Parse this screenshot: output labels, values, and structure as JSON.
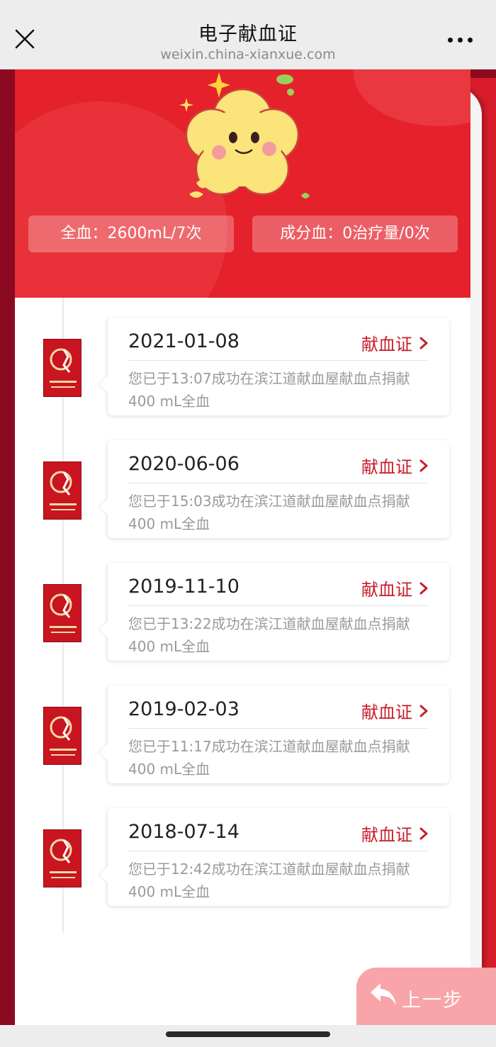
{
  "header": {
    "title": "电子献血证",
    "url": "weixin.china-xianxue.com"
  },
  "summary": {
    "whole_blood": "全血：2600mL/7次",
    "component_blood": "成分血：0治疗量/0次"
  },
  "records": [
    {
      "date": "2021-01-08",
      "link_label": "献血证",
      "description": "您已于13:07成功在滨江道献血屋献血点捐献400 mL全血"
    },
    {
      "date": "2020-06-06",
      "link_label": "献血证",
      "description": "您已于15:03成功在滨江道献血屋献血点捐献400 mL全血"
    },
    {
      "date": "2019-11-10",
      "link_label": "献血证",
      "description": "您已于13:22成功在滨江道献血屋献血点捐献400 mL全血"
    },
    {
      "date": "2019-02-03",
      "link_label": "献血证",
      "description": "您已于11:17成功在滨江道献血屋献血点捐献400 mL全血"
    },
    {
      "date": "2018-07-14",
      "link_label": "献血证",
      "description": "您已于12:42成功在滨江道献血屋献血点捐献400 mL全血"
    }
  ],
  "back_button": {
    "label": "上一步"
  },
  "icons": {
    "close": "close-icon",
    "more": "more-icon",
    "chevron": "chevron-right-icon",
    "back_arrow": "reply-arrow-icon",
    "badge": "blood-certificate-badge-icon"
  },
  "colors": {
    "brand_red": "#e5212b",
    "dark_red": "#8c0a20",
    "link_red": "#c81d2c",
    "back_button": "#f8a4a8"
  }
}
